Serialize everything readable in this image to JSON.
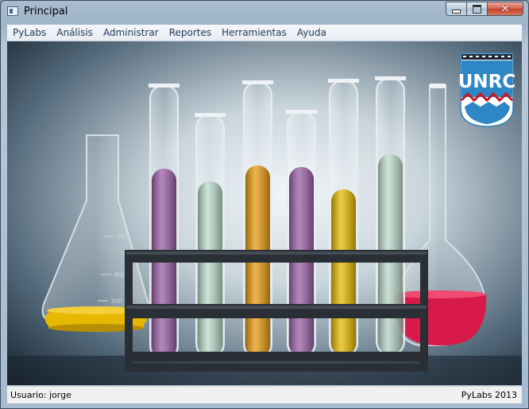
{
  "window": {
    "title": "Principal"
  },
  "menu": [
    "PyLabs",
    "Análisis",
    "Administrar",
    "Reportes",
    "Herramientas",
    "Ayuda"
  ],
  "image": {
    "logo_text": "UNRC",
    "flask_marks": [
      "500",
      "400",
      "300"
    ],
    "colors": {
      "yellow": "#e6b800",
      "purple": "#9a5fa6",
      "green": "#b9d9c8",
      "orange": "#e89a10",
      "red": "#d81a4a"
    }
  },
  "status": {
    "user": "Usuario: jorge",
    "brand": "PyLabs 2013"
  }
}
